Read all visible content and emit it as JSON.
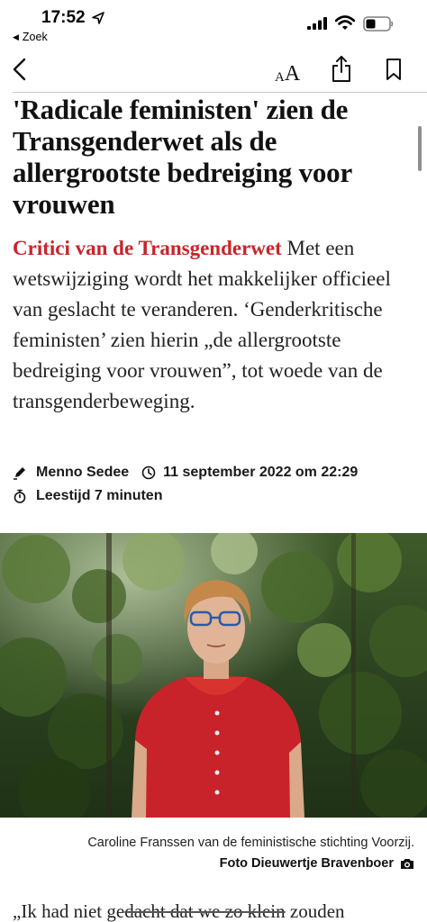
{
  "status_bar": {
    "time": "17:52",
    "back_app": "Zoek",
    "icons": [
      "location-arrow-icon",
      "cellular-signal-icon",
      "wifi-icon",
      "battery-icon"
    ]
  },
  "nav": {
    "font_size_small": "A",
    "font_size_big": "A",
    "icons": [
      "back-chevron-icon",
      "font-size-icon",
      "share-icon",
      "bookmark-icon"
    ]
  },
  "article": {
    "headline": "'Radicale feministen' zien de Transgenderwet als de allergrootste bedreiging voor vrouwen",
    "kicker": "Critici van de Transgenderwet",
    "lead": "Met een wetswijziging wordt het makkelijker officieel van geslacht te veranderen. ‘Genderkritische feministen’ zien hierin „de allergrootste bedreiging voor vrouwen”, tot woede van de transgenderbeweging.",
    "author": "Menno Sedee",
    "date": "11 september 2022 om 22:29",
    "reading_time": "Leestijd 7 minuten",
    "caption": "Caroline Franssen van de feministische stichting Voorzij.",
    "photo_credit": "Foto Dieuwertje Bravenboer",
    "body_start_a": "„Ik had niet ge",
    "body_start_strike": "dacht dat we zo klein",
    "body_start_b": " zouden"
  },
  "colors": {
    "accent": "#c7252b",
    "text": "#1a1a1a",
    "background": "#ffffff",
    "divider": "#c8c8c8"
  }
}
